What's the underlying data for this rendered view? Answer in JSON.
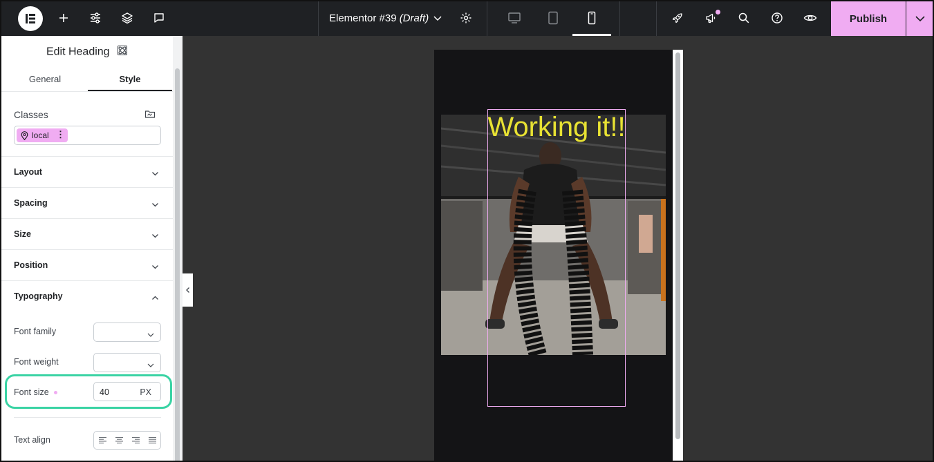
{
  "topbar": {
    "document_title": "Elementor #39",
    "document_status": "(Draft)",
    "publish_label": "Publish"
  },
  "panel": {
    "title": "Edit Heading",
    "tabs": [
      {
        "label": "General"
      },
      {
        "label": "Style"
      }
    ],
    "active_tab": "Style",
    "classes": {
      "label": "Classes",
      "chips": [
        {
          "label": "local"
        }
      ]
    },
    "sections": [
      {
        "label": "Layout"
      },
      {
        "label": "Spacing"
      },
      {
        "label": "Size"
      },
      {
        "label": "Position"
      },
      {
        "label": "Typography"
      }
    ],
    "typography": {
      "font_family_label": "Font family",
      "font_family_value": "",
      "font_weight_label": "Font weight",
      "font_weight_value": "",
      "font_size_label": "Font size",
      "font_size_value": "40",
      "font_size_unit": "PX",
      "text_align_label": "Text align"
    }
  },
  "canvas": {
    "heading_text": "Working it!!"
  },
  "colors": {
    "accent": "#f0acf2",
    "highlight": "#3ad3a4",
    "topbar": "#1f2124",
    "canvas": "#333333",
    "heading": "#e8e233"
  }
}
